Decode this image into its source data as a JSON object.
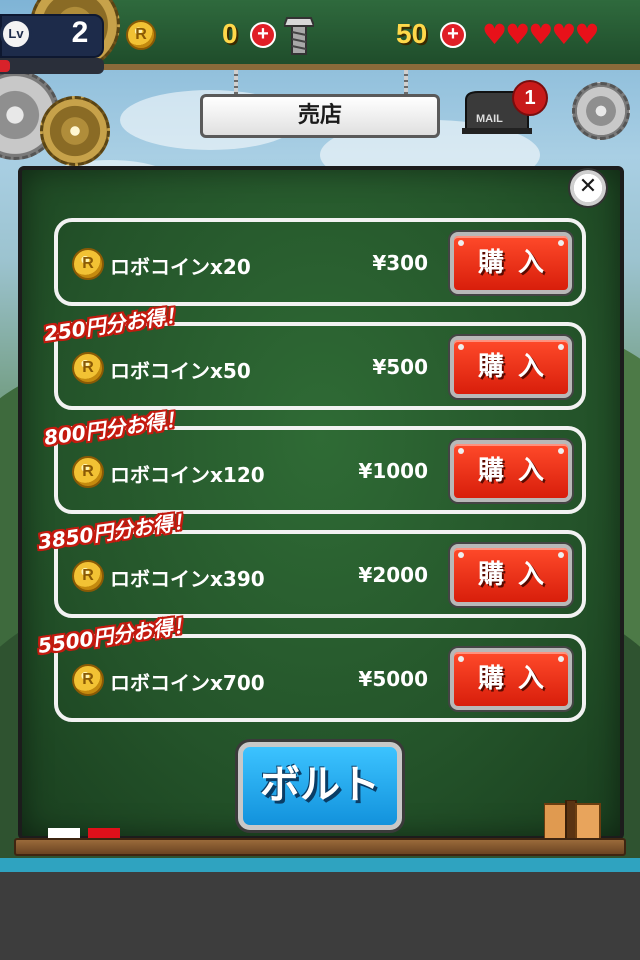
{
  "hud": {
    "level_label": "Lv",
    "level": "2",
    "level_progress": 0.1,
    "coin_count": "0",
    "bolt_count": "50",
    "hearts": 5,
    "plus_symbol": "+"
  },
  "shop": {
    "title": "売店",
    "mail_badge": "1",
    "mail_label": "MAIL",
    "close_symbol": "✕",
    "coin_glyph": "R",
    "buy_label": "購入",
    "items": [
      {
        "name": "ロボコインx20",
        "price": "¥300",
        "banner": ""
      },
      {
        "name": "ロボコインx50",
        "price": "¥500",
        "banner": "250円分お得！"
      },
      {
        "name": "ロボコインx120",
        "price": "¥1000",
        "banner": "800円分お得！"
      },
      {
        "name": "ロボコインx390",
        "price": "¥2000",
        "banner": "3850円分お得！"
      },
      {
        "name": "ロボコインx700",
        "price": "¥5000",
        "banner": "5500円分お得！"
      }
    ],
    "bolt_tab_label": "ボルト"
  },
  "colors": {
    "panel_green": "#24542a",
    "buy_red": "#d81e0b",
    "bolt_blue": "#1292dc",
    "gold": "#ffd84a"
  }
}
